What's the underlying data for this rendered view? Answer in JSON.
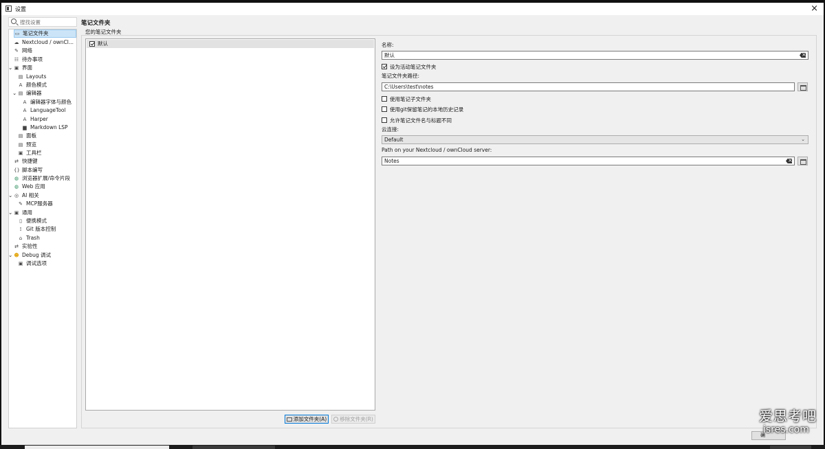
{
  "window": {
    "title": "设置"
  },
  "search": {
    "placeholder": "搜找设置"
  },
  "sidebar": {
    "items": [
      {
        "label": "笔记文件夹"
      },
      {
        "label": "Nextcloud / ownCl..."
      },
      {
        "label": "网络"
      },
      {
        "label": "待办事项"
      },
      {
        "label": "界面"
      },
      {
        "label": "Layouts"
      },
      {
        "label": "颜色模式"
      },
      {
        "label": "编辑器"
      },
      {
        "label": "编辑器字体与颜色"
      },
      {
        "label": "LanguageTool"
      },
      {
        "label": "Harper"
      },
      {
        "label": "Markdown LSP"
      },
      {
        "label": "面板"
      },
      {
        "label": "预览"
      },
      {
        "label": "工具栏"
      },
      {
        "label": "快捷键"
      },
      {
        "label": "脚本编写"
      },
      {
        "label": "浏览器扩展/命令片段"
      },
      {
        "label": "Web 应用"
      },
      {
        "label": "AI 相关"
      },
      {
        "label": "MCP服务器"
      },
      {
        "label": "通用"
      },
      {
        "label": "便携模式"
      },
      {
        "label": "Git 版本控制"
      },
      {
        "label": "Trash"
      },
      {
        "label": "实验性"
      },
      {
        "label": "Debug 调试"
      },
      {
        "label": "调试选项"
      }
    ]
  },
  "main": {
    "title": "笔记文件夹",
    "subtitle": "您的笔记文件夹",
    "folders": [
      {
        "name": "默认",
        "checked": true
      }
    ],
    "add_folder_label": "添加文件夹(A)",
    "remove_folder_label": "移除文件夹(R)"
  },
  "form": {
    "name_label": "名称:",
    "name_value": "默认",
    "set_active_label": "设为活动笔记文件夹",
    "path_label": "笔记文件夹路径:",
    "path_value": "C:\\Users\\test\\notes",
    "use_subfolders_label": "使用笔记子文件夹",
    "git_history_label": "使用git保留笔记的本地历史记录",
    "allow_diff_names_label": "允许笔记文件名与标题不同",
    "cloud_label": "云连接:",
    "cloud_value": "Default",
    "server_path_label": "Path on your Nextcloud / ownCloud server:",
    "server_path_value": "Notes"
  },
  "footer": {
    "ok_label": "确"
  },
  "watermark": {
    "line1": "爱思考吧",
    "line2": "isres.com"
  }
}
